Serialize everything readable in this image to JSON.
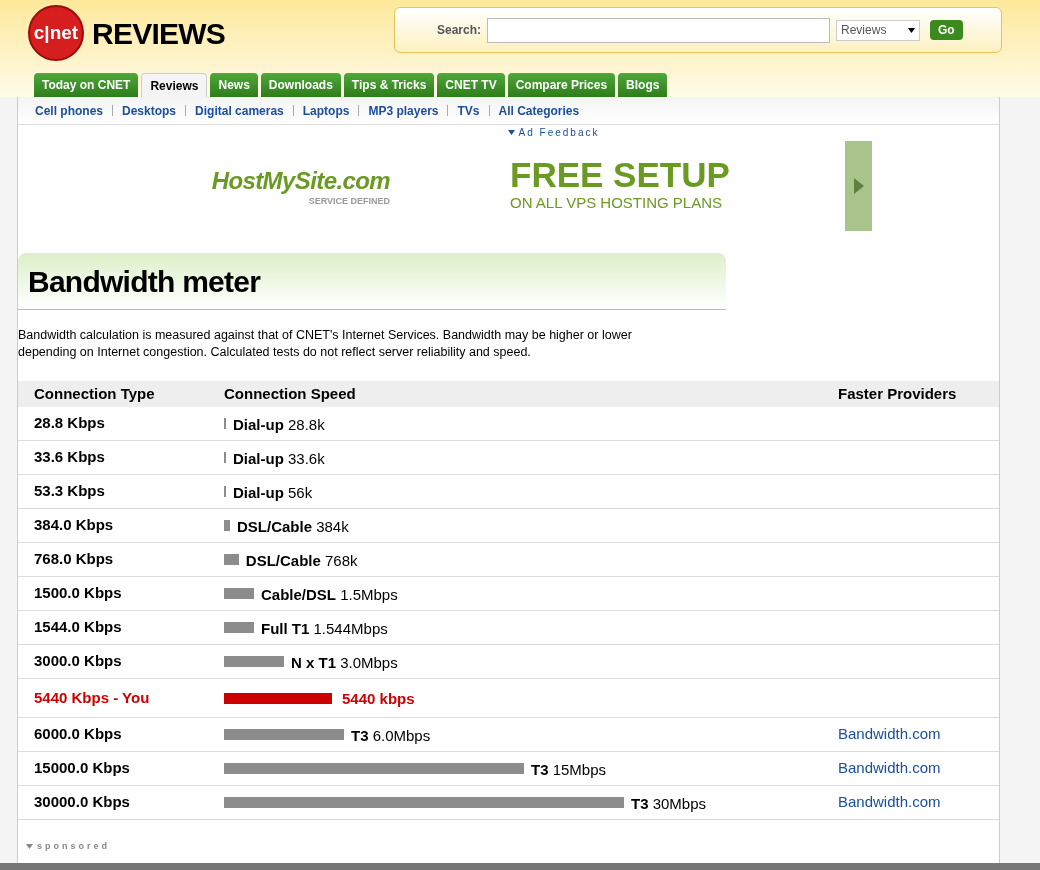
{
  "header": {
    "logo": "c|net",
    "section": "REVIEWS",
    "search": {
      "label": "Search:",
      "scope": "Reviews",
      "button": "Go"
    }
  },
  "tabs": [
    {
      "label": "Today on CNET",
      "selected": false
    },
    {
      "label": "Reviews",
      "selected": true
    },
    {
      "label": "News",
      "selected": false
    },
    {
      "label": "Downloads",
      "selected": false
    },
    {
      "label": "Tips & Tricks",
      "selected": false
    },
    {
      "label": "CNET TV",
      "selected": false
    },
    {
      "label": "Compare Prices",
      "selected": false
    },
    {
      "label": "Blogs",
      "selected": false
    }
  ],
  "subnav": [
    "Cell phones",
    "Desktops",
    "Digital cameras",
    "Laptops",
    "MP3 players",
    "TVs",
    "All Categories"
  ],
  "ad": {
    "feedback": "Ad Feedback",
    "brand": "HostMySite.com",
    "tagline": "SERVICE DEFINED",
    "headline": "FREE SETUP",
    "subline": "ON ALL VPS HOSTING PLANS"
  },
  "title": "Bandwidth meter",
  "description": "Bandwidth calculation is measured against that of CNET's Internet Services. Bandwidth may be higher or lower depending on Internet congestion. Calculated tests do not reflect server reliability and speed.",
  "table": {
    "columns": [
      "Connection Type",
      "Connection Speed",
      "Faster Providers"
    ],
    "rows": [
      {
        "kind": "reference",
        "type": "28.8 Kbps",
        "level": 0.005,
        "speed": "**Dial-up** 28.8k"
      },
      {
        "kind": "reference",
        "type": "33.6 Kbps",
        "level": 0.005,
        "speed": "**Dial-up** 33.6k"
      },
      {
        "kind": "reference",
        "type": "53.3 Kbps",
        "level": 0.005,
        "speed": "**Dial-up** 56k"
      },
      {
        "kind": "reference",
        "type": "384.0 Kbps",
        "level": 0.015,
        "speed": "**DSL/Cable** 384k"
      },
      {
        "kind": "reference",
        "type": "768.0 Kbps",
        "level": 0.037,
        "speed": "**DSL/Cable** 768k"
      },
      {
        "kind": "reference",
        "type": "1500.0 Kbps",
        "level": 0.075,
        "speed": "**Cable/DSL** 1.5Mbps"
      },
      {
        "kind": "reference",
        "type": "1544.0 Kbps",
        "level": 0.075,
        "speed": "**Full T1** 1.544Mbps"
      },
      {
        "kind": "reference",
        "type": "3000.0 Kbps",
        "level": 0.15,
        "speed": "**N x T1** 3.0Mbps"
      },
      {
        "kind": "user",
        "type": "5440 Kbps - You",
        "level": 0.27,
        "speed": "5440 kbps"
      },
      {
        "kind": "reference",
        "type": "6000.0 Kbps",
        "level": 0.3,
        "speed": "**T3** 6.0Mbps",
        "provider": "Bandwidth.com"
      },
      {
        "kind": "reference",
        "type": "15000.0 Kbps",
        "level": 0.75,
        "speed": "**T3** 15Mbps",
        "provider": "Bandwidth.com"
      },
      {
        "kind": "reference",
        "type": "30000.0 Kbps",
        "level": 1,
        "speed": "**T3** 30Mbps",
        "provider": "Bandwidth.com"
      }
    ]
  },
  "sponsored": "sponsored"
}
